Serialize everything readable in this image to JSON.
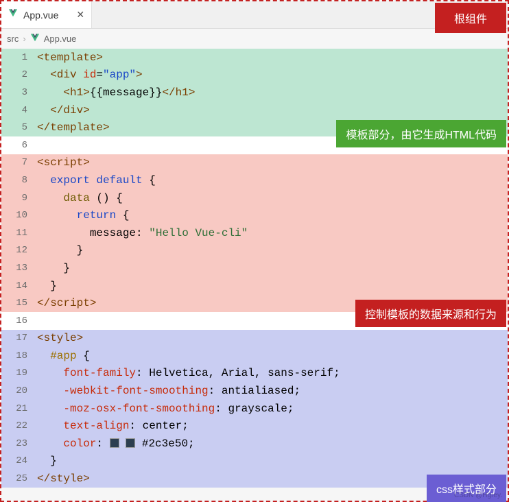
{
  "tab": {
    "label": "App.vue",
    "close": "✕"
  },
  "badges": {
    "root": "根组件",
    "template": "模板部分，由它生成HTML代码",
    "script": "控制模板的数据来源和行为",
    "style": "css样式部分"
  },
  "breadcrumb": {
    "item1": "src",
    "sep": "›",
    "item2": "App.vue"
  },
  "watermark": "CSDN @Hgrey.",
  "code": {
    "lines": [
      {
        "n": "1",
        "bg": "green",
        "html": "<span class='tok-tag'>&lt;template&gt;</span>"
      },
      {
        "n": "2",
        "bg": "green",
        "html": "  <span class='tok-tag'>&lt;div</span> <span class='tok-attr'>id</span>=<span class='tok-str'>\"app\"</span><span class='tok-tag'>&gt;</span>"
      },
      {
        "n": "3",
        "bg": "green",
        "html": "    <span class='tok-tag'>&lt;h1&gt;</span>{{message}}<span class='tok-tag'>&lt;/h1&gt;</span>"
      },
      {
        "n": "4",
        "bg": "green",
        "html": "  <span class='tok-tag'>&lt;/div&gt;</span>"
      },
      {
        "n": "5",
        "bg": "green",
        "html": "<span class='tok-tag'>&lt;/template&gt;</span>"
      },
      {
        "n": "6",
        "bg": "white",
        "html": ""
      },
      {
        "n": "7",
        "bg": "red",
        "html": "<span class='tok-tag'>&lt;script&gt;</span>"
      },
      {
        "n": "8",
        "bg": "red",
        "html": "  <span class='tok-kw'>export</span> <span class='tok-kw'>default</span> {"
      },
      {
        "n": "9",
        "bg": "red",
        "html": "    <span class='tok-fn'>data</span> () {"
      },
      {
        "n": "10",
        "bg": "red",
        "html": "      <span class='tok-kw'>return</span> {"
      },
      {
        "n": "11",
        "bg": "red",
        "html": "        message: <span class='tok-val'>\"Hello Vue-cli\"</span>"
      },
      {
        "n": "12",
        "bg": "red",
        "html": "      }"
      },
      {
        "n": "13",
        "bg": "red",
        "html": "    }"
      },
      {
        "n": "14",
        "bg": "red",
        "html": "  }"
      },
      {
        "n": "15",
        "bg": "red",
        "html": "<span class='tok-tag'>&lt;/script&gt;</span>"
      },
      {
        "n": "16",
        "bg": "white",
        "html": ""
      },
      {
        "n": "17",
        "bg": "blue",
        "html": "<span class='tok-tag'>&lt;style&gt;</span>"
      },
      {
        "n": "18",
        "bg": "blue",
        "html": "  <span class='tok-sel'>#app</span> {"
      },
      {
        "n": "19",
        "bg": "blue",
        "html": "    <span class='tok-prop'>font-family</span>: Helvetica, Arial, sans-serif;"
      },
      {
        "n": "20",
        "bg": "blue",
        "html": "    <span class='tok-prop'>-webkit-font-smoothing</span>: antialiased;"
      },
      {
        "n": "21",
        "bg": "blue",
        "html": "    <span class='tok-prop'>-moz-osx-font-smoothing</span>: grayscale;"
      },
      {
        "n": "22",
        "bg": "blue",
        "html": "    <span class='tok-prop'>text-align</span>: center;"
      },
      {
        "n": "23",
        "bg": "blue",
        "html": "    <span class='tok-prop'>color</span>: <span class='color-sw'></span> <span class='color-sw'></span> #2c3e50;"
      },
      {
        "n": "24",
        "bg": "blue",
        "html": "  }"
      },
      {
        "n": "25",
        "bg": "blue",
        "html": "<span class='tok-tag'>&lt;/style&gt;</span>"
      }
    ]
  }
}
